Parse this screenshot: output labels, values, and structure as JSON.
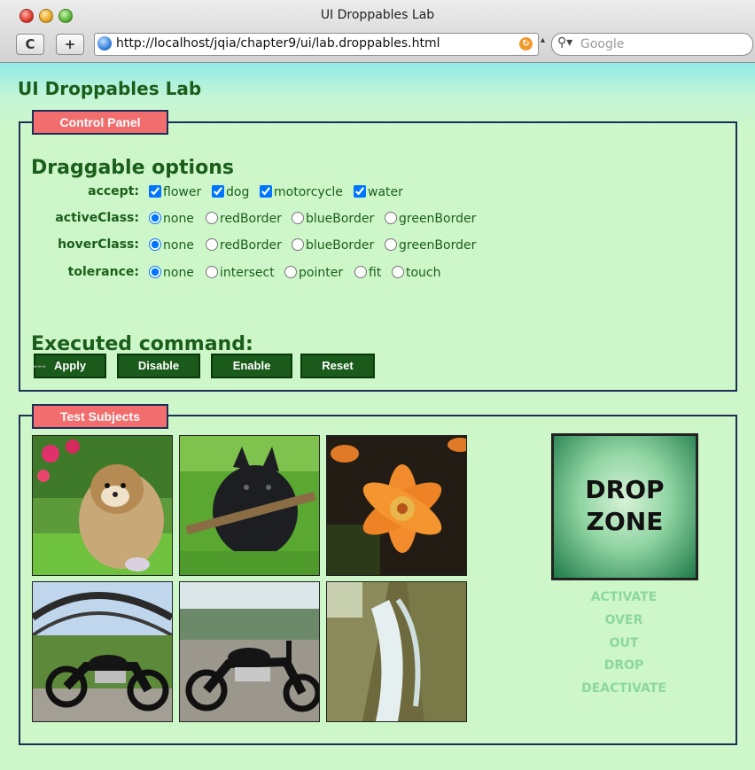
{
  "window": {
    "title": "UI Droppables Lab"
  },
  "toolbar": {
    "reload_label": "C",
    "add_label": "+",
    "url": "http://localhost/jqia/chapter9/ui/lab.droppables.html",
    "search_placeholder": "Google"
  },
  "page": {
    "title": "UI Droppables Lab"
  },
  "control_panel": {
    "legend": "Control Panel",
    "heading": "Draggable options",
    "accept": {
      "label": "accept:",
      "options": [
        {
          "label": "flower",
          "checked": true
        },
        {
          "label": "dog",
          "checked": true
        },
        {
          "label": "motorcycle",
          "checked": true
        },
        {
          "label": "water",
          "checked": true
        }
      ]
    },
    "activeClass": {
      "label": "activeClass:",
      "options": [
        "none",
        "redBorder",
        "blueBorder",
        "greenBorder"
      ],
      "selected": "none"
    },
    "hoverClass": {
      "label": "hoverClass:",
      "options": [
        "none",
        "redBorder",
        "blueBorder",
        "greenBorder"
      ],
      "selected": "none"
    },
    "tolerance": {
      "label": "tolerance:",
      "options": [
        "none",
        "intersect",
        "pointer",
        "fit",
        "touch"
      ],
      "selected": "none"
    },
    "buttons": {
      "apply": "Apply",
      "disable": "Disable",
      "enable": "Enable",
      "reset": "Reset"
    },
    "executed_heading": "Executed command:",
    "executed_value": "---"
  },
  "test_subjects": {
    "legend": "Test Subjects",
    "images": [
      "dog",
      "dog",
      "flower",
      "motorcycle",
      "motorcycle",
      "water"
    ],
    "drop_zone": {
      "line1": "DROP",
      "line2": "ZONE"
    },
    "events": [
      "ACTIVATE",
      "OVER",
      "OUT",
      "DROP",
      "DEACTIVATE"
    ]
  }
}
